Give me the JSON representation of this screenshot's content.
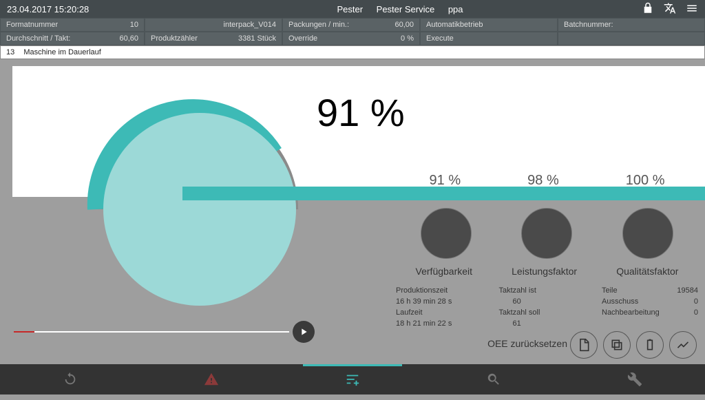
{
  "header": {
    "datetime": "23.04.2017 15:20:28",
    "brand": "Pester",
    "service": "Pester Service",
    "user": "ppa"
  },
  "grid": {
    "r1c1_label": "Formatnummer",
    "r1c1_val": "10",
    "r1c2_val": "interpack_V014",
    "r1c3_label": "Packungen / min.:",
    "r1c3_val": "60,00",
    "r1c4_label": "Automatikbetrieb",
    "r1c5_label": "Batchnummer:",
    "r2c1_label": "Durchschnitt / Takt:",
    "r2c1_val": "60,60",
    "r2c2_label": "Produktzähler",
    "r2c2_val": "3381 Stück",
    "r2c3_label": "Override",
    "r2c3_val": "0 %",
    "r2c4_label": "Execute"
  },
  "status": {
    "code": "13",
    "text": "Maschine im Dauerlauf"
  },
  "oee": {
    "percent": "91 %",
    "avail_pct": "91 %",
    "perf_pct": "98 %",
    "qual_pct": "100 %",
    "avail_label": "Verfügbarkeit",
    "perf_label": "Leistungsfaktor",
    "qual_label": "Qualitätsfaktor",
    "avail": {
      "l1": "Produktionszeit",
      "v1": "16 h  39 min  28 s",
      "l2": "Laufzeit",
      "v2": "18 h  21 min  22 s"
    },
    "perf": {
      "l1": "Taktzahl ist",
      "v1": "60",
      "l2": "Taktzahl soll",
      "v2": "61"
    },
    "qual": {
      "l1": "Teile",
      "v1": "19584",
      "l2": "Ausschuss",
      "v2": "0",
      "l3": "Nachbearbeitung",
      "v3": "0"
    },
    "reset_label": "OEE zurücksetzen"
  },
  "chart_data": {
    "type": "gauge",
    "title": "OEE",
    "value": 91,
    "max": 100,
    "unit": "%",
    "components": [
      {
        "name": "Verfügbarkeit",
        "value": 91
      },
      {
        "name": "Leistungsfaktor",
        "value": 98
      },
      {
        "name": "Qualitätsfaktor",
        "value": 100
      }
    ]
  }
}
